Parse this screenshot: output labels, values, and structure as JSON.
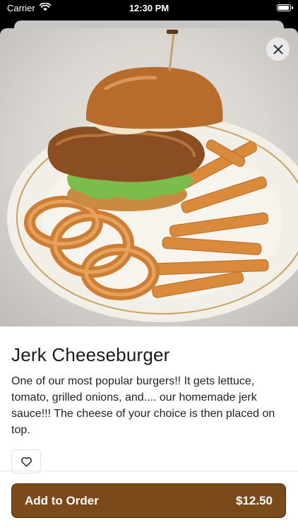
{
  "status_bar": {
    "carrier": "Carrier",
    "time": "12:30 PM",
    "battery_level": 1.0
  },
  "item": {
    "image_alt": "Burger with onion rings and fries",
    "title": "Jerk Cheeseburger",
    "description": "One of our most popular burgers!! It gets lettuce, tomato, grilled onions, and.... our homemade jerk sauce!!! The cheese of your choice is then placed on top."
  },
  "actions": {
    "add_label": "Add to Order",
    "price": "$12.50"
  },
  "icons": {
    "close": "close-icon",
    "favorite": "heart-icon",
    "wifi": "wifi-icon",
    "battery": "battery-icon"
  },
  "colors": {
    "accent": "#7b4a1a",
    "accent_border": "#4d2d0d"
  }
}
